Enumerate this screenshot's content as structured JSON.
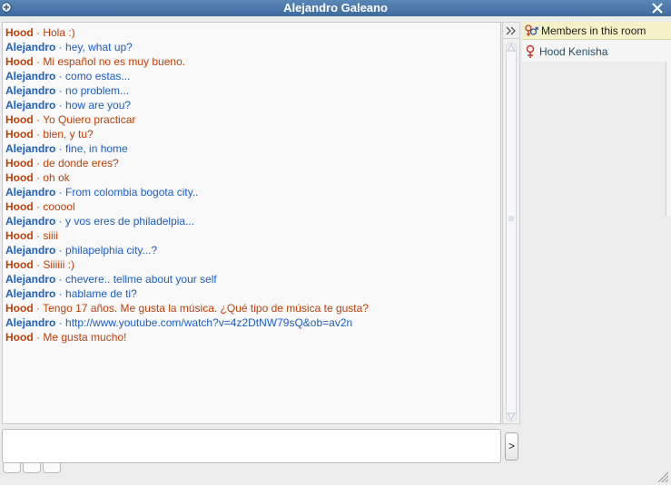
{
  "window": {
    "title": "Alejandro Galeano",
    "icons": {
      "corner": "plus-circle-icon",
      "close": "close-icon"
    }
  },
  "colors": {
    "titlebar": "#3d6b9e",
    "hood": "#b8420d",
    "alejandro": "#1f5fbf",
    "link": "#1f5fbf",
    "members_header": "#f4f1c8"
  },
  "chat": {
    "separator": " · ",
    "messages": [
      {
        "sender": "Hood",
        "text": "Hola :)"
      },
      {
        "sender": "Alejandro",
        "text": "hey, what up?"
      },
      {
        "sender": "Hood",
        "text": "Mi español no es muy bueno."
      },
      {
        "sender": "Alejandro",
        "text": "como estas..."
      },
      {
        "sender": "Alejandro",
        "text": "no problem..."
      },
      {
        "sender": "Alejandro",
        "text": "how are you?"
      },
      {
        "sender": "Hood",
        "text": "Yo Quiero practicar"
      },
      {
        "sender": "Hood",
        "text": "bien, y tu?"
      },
      {
        "sender": "Alejandro",
        "text": "fine, in home"
      },
      {
        "sender": "Hood",
        "text": "de donde eres?"
      },
      {
        "sender": "Hood",
        "text": "oh ok"
      },
      {
        "sender": "Alejandro",
        "text": "From colombia bogota city.."
      },
      {
        "sender": "Hood",
        "text": "cooool"
      },
      {
        "sender": "Alejandro",
        "text": "y vos eres de philadelpia..."
      },
      {
        "sender": "Hood",
        "text": "siiii"
      },
      {
        "sender": "Alejandro",
        "text": "philapelphia city...?"
      },
      {
        "sender": "Hood",
        "text": "Siiiiii :)"
      },
      {
        "sender": "Alejandro",
        "text": "chevere.. tellme about your self"
      },
      {
        "sender": "Alejandro",
        "text": "hablame de ti?"
      },
      {
        "sender": "Hood",
        "text": "Tengo 17 años. Me gusta la música. ¿Qué tipo de música te gusta?"
      },
      {
        "sender": "Alejandro",
        "text": "http://www.youtube.com/watch?v=4z2DtNW79sQ&ob=av2n"
      },
      {
        "sender": "Hood",
        "text": "Me gusta mucho!"
      }
    ]
  },
  "members": {
    "header": "Members in this room",
    "header_icon": "gender-pair-icon",
    "list": [
      {
        "name": "Hood Kenisha",
        "icon": "female-icon"
      }
    ]
  },
  "input": {
    "value": "",
    "placeholder": "",
    "send_label": ">"
  },
  "scroll_toggle_icon": "double-chevron-right-icon"
}
